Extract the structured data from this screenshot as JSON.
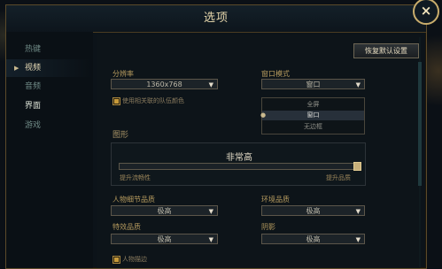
{
  "dialog": {
    "title": "选项",
    "close_label": "×"
  },
  "sidebar": {
    "items": [
      {
        "label": "热键"
      },
      {
        "label": "视频"
      },
      {
        "label": "音频"
      },
      {
        "label": "界面"
      },
      {
        "label": "游戏"
      }
    ]
  },
  "toolbar": {
    "reset_label": "恢复默认设置"
  },
  "resolution": {
    "label": "分辨率",
    "value": "1360x768",
    "arrow": "▼"
  },
  "party_color": {
    "label": "使用相关联的队伍颜色"
  },
  "window_mode": {
    "label": "窗口模式",
    "value": "窗口",
    "arrow": "▼",
    "options": [
      "全屏",
      "窗口",
      "无边框"
    ]
  },
  "graphics": {
    "section_title": "图形",
    "quality_value": "非常高",
    "slider_left_caption": "提升流畅性",
    "slider_right_caption": "提升品质",
    "slider_level": 1.0
  },
  "character_quality": {
    "label": "人物细节品质",
    "value": "极高"
  },
  "environment_quality": {
    "label": "环境品质",
    "value": "极高"
  },
  "effects_quality": {
    "label": "特效品质",
    "value": "极高"
  },
  "shadows": {
    "label": "阴影",
    "value": "极高"
  },
  "character_inking": {
    "label": "人物描边"
  },
  "colors": {
    "accent": "#c9b98f",
    "panel": "#0d1419",
    "border": "#5b4a2a"
  }
}
